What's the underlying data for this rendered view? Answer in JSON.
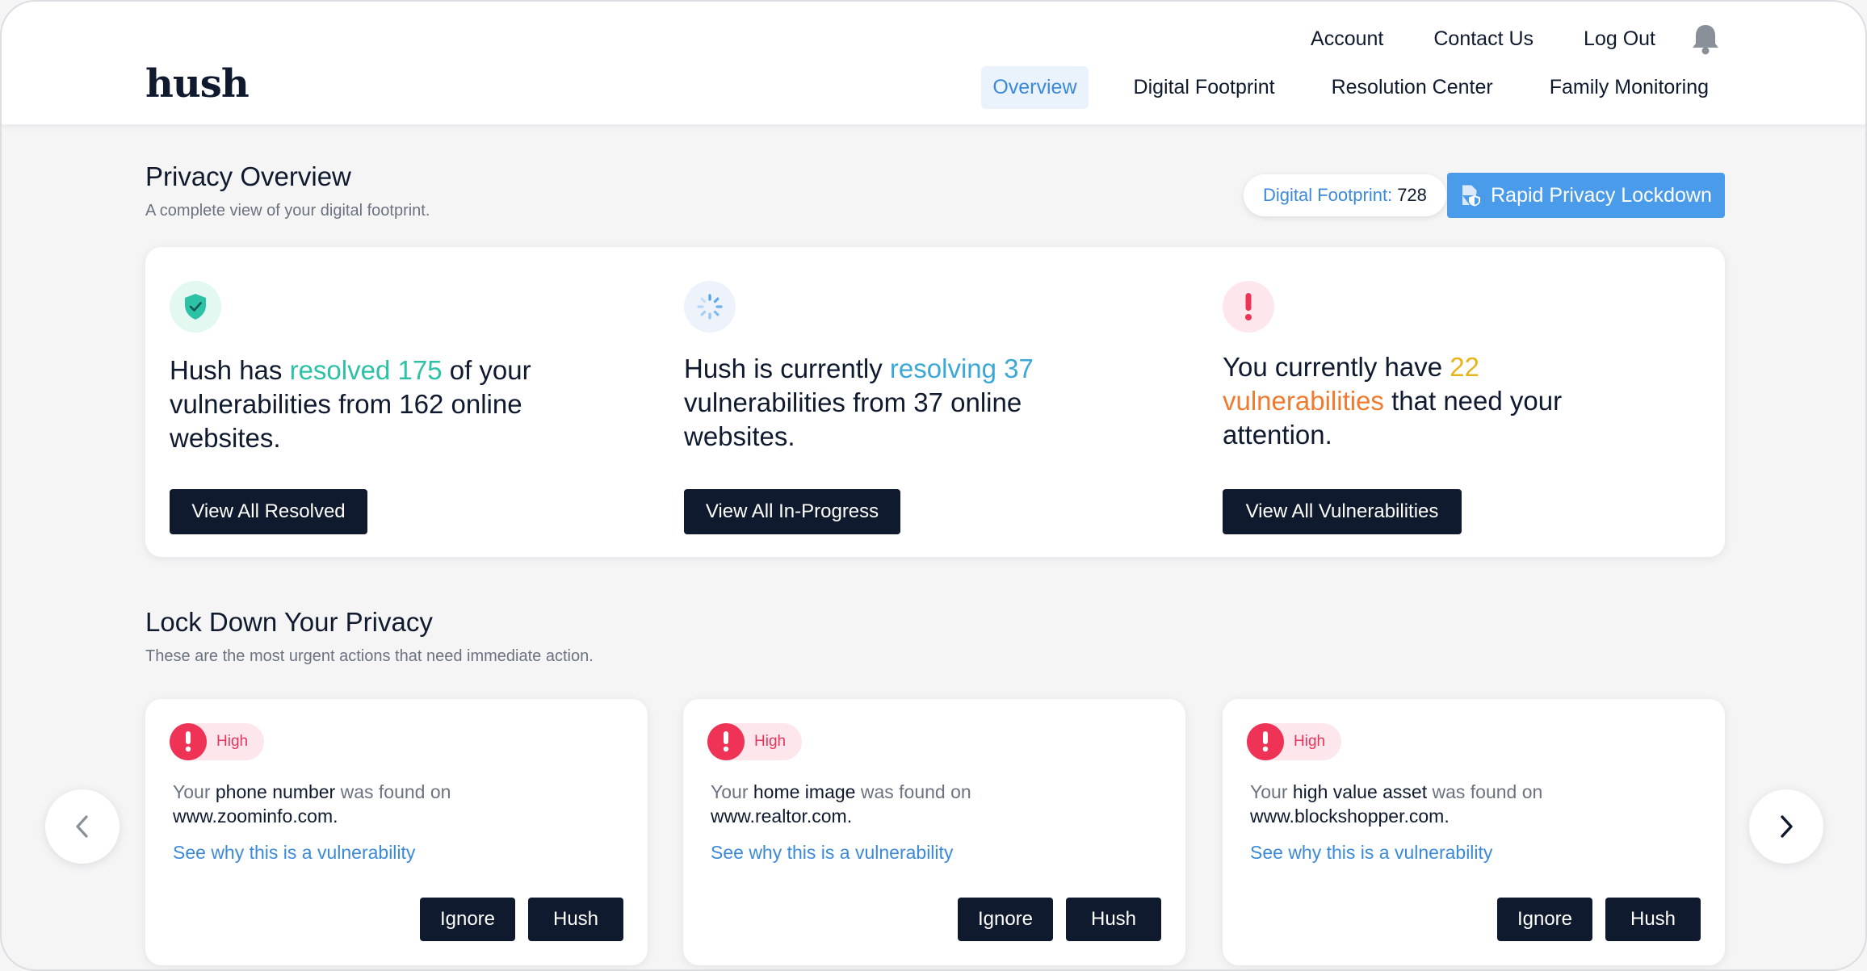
{
  "header": {
    "logo": "hush",
    "top_links": [
      "Account",
      "Contact Us",
      "Log Out"
    ],
    "nav": [
      {
        "label": "Overview",
        "active": true
      },
      {
        "label": "Digital Footprint",
        "active": false
      },
      {
        "label": "Resolution Center",
        "active": false
      },
      {
        "label": "Family Monitoring",
        "active": false
      }
    ],
    "notification_icon": "bell-icon"
  },
  "privacy_overview": {
    "title": "Privacy Overview",
    "subtitle": "A complete view of your digital footprint.",
    "footprint_label": "Digital Footprint:",
    "footprint_value": "728",
    "lockdown_label": "Rapid Privacy Lockdown",
    "cards": [
      {
        "icon": "shield-check-icon",
        "pre": "Hush has ",
        "highlight": "resolved 175",
        "post": " of your vulnerabilities from 162 online websites.",
        "button": "View All Resolved"
      },
      {
        "icon": "spinner-icon",
        "pre": "Hush is currently ",
        "highlight": "resolving 37",
        "post": " vulnerabilities from 37 online websites.",
        "button": "View All In-Progress"
      },
      {
        "icon": "exclamation-icon",
        "pre": "You currently have ",
        "highlight_num": "22",
        "highlight_word": "vulnerabilities",
        "post": " that need your attention.",
        "button": "View All Vulnerabilities"
      }
    ]
  },
  "lockdown": {
    "title": "Lock Down Your Privacy",
    "subtitle": "These are the most urgent actions that need immediate action.",
    "cards": [
      {
        "severity": "High",
        "pre": "Your ",
        "item": "phone number",
        "mid": " was found on",
        "site": "www.zoominfo.com.",
        "link": "See why this is a vulnerability",
        "ignore": "Ignore",
        "hush": "Hush"
      },
      {
        "severity": "High",
        "pre": "Your ",
        "item": "home image",
        "mid": " was found on",
        "site": "www.realtor.com.",
        "link": "See why this is a vulnerability",
        "ignore": "Ignore",
        "hush": "Hush"
      },
      {
        "severity": "High",
        "pre": "Your ",
        "item": "high value asset",
        "mid": " was found on",
        "site": "www.blockshopper.com.",
        "link": "See why this is a vulnerability",
        "ignore": "Ignore",
        "hush": "Hush"
      }
    ]
  },
  "colors": {
    "navy": "#0f1a2e",
    "accent_blue": "#3b8ad9",
    "button_blue": "#4a9bea",
    "teal": "#2dc1a6",
    "high_red": "#ee3356"
  }
}
